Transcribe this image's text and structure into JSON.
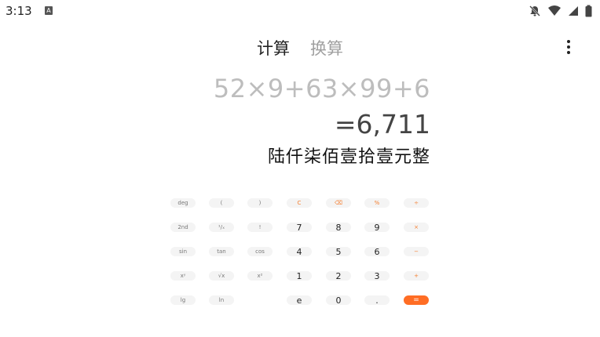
{
  "status": {
    "time": "3:13",
    "a_badge": "A"
  },
  "tabs": [
    {
      "label": "计算",
      "active": true
    },
    {
      "label": "换算",
      "active": false
    }
  ],
  "display": {
    "expression": "52×9+63×99+6",
    "result": "=6,711",
    "chinese_amount": "陆仟柒佰壹拾壹元整"
  },
  "keypad": {
    "rows": [
      [
        {
          "label": "deg"
        },
        {
          "label": "("
        },
        {
          "label": ")"
        },
        {
          "label": "C",
          "accent": true
        },
        {
          "label": "⌫",
          "accent": true
        },
        {
          "label": "%",
          "accent": true
        },
        {
          "label": "÷",
          "accent": true
        }
      ],
      [
        {
          "label": "2nd"
        },
        {
          "label": "¹/ₓ"
        },
        {
          "label": "!"
        },
        {
          "label": "7",
          "num": true
        },
        {
          "label": "8",
          "num": true
        },
        {
          "label": "9",
          "num": true
        },
        {
          "label": "×",
          "accent": true
        }
      ],
      [
        {
          "label": "sin"
        },
        {
          "label": "tan"
        },
        {
          "label": "cos"
        },
        {
          "label": "4",
          "num": true
        },
        {
          "label": "5",
          "num": true
        },
        {
          "label": "6",
          "num": true
        },
        {
          "label": "−",
          "accent": true
        }
      ],
      [
        {
          "label": "xʸ"
        },
        {
          "label": "√x"
        },
        {
          "label": "x²"
        },
        {
          "label": "1",
          "num": true
        },
        {
          "label": "2",
          "num": true
        },
        {
          "label": "3",
          "num": true
        },
        {
          "label": "+",
          "accent": true
        }
      ],
      [
        {
          "label": "lg"
        },
        {
          "label": "ln"
        },
        {
          "label": ""
        },
        {
          "label": "e",
          "num": true
        },
        {
          "label": "0",
          "num": true
        },
        {
          "label": ".",
          "num": true
        },
        {
          "label": "=",
          "equals": true
        }
      ]
    ]
  },
  "colors": {
    "accent": "#ff6d24",
    "expression": "#bdbdbd",
    "result": "#444444"
  }
}
